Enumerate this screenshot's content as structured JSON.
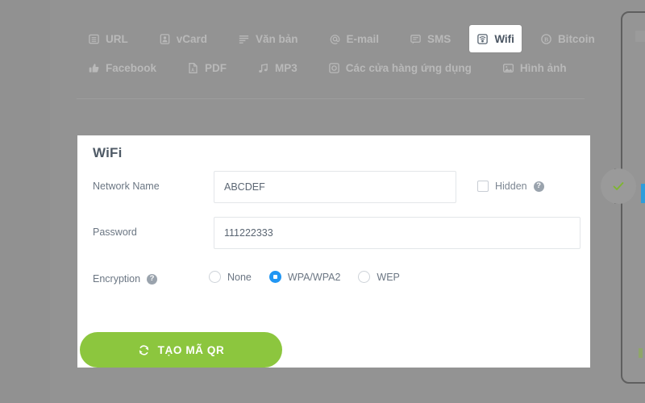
{
  "tabs": {
    "row1": [
      {
        "label": "URL",
        "icon": "document-icon",
        "active": false
      },
      {
        "label": "vCard",
        "icon": "contact-card-icon",
        "active": false
      },
      {
        "label": "Văn bản",
        "icon": "text-lines-icon",
        "active": false
      },
      {
        "label": "E-mail",
        "icon": "at-sign-icon",
        "active": false
      },
      {
        "label": "SMS",
        "icon": "speech-bubble-icon",
        "active": false
      },
      {
        "label": "Wifi",
        "icon": "wifi-icon",
        "active": true
      },
      {
        "label": "Bitcoin",
        "icon": "bitcoin-icon",
        "active": false
      }
    ],
    "row2": [
      {
        "label": "Facebook",
        "icon": "thumbs-up-icon",
        "active": false
      },
      {
        "label": "PDF",
        "icon": "pdf-file-icon",
        "active": false
      },
      {
        "label": "MP3",
        "icon": "music-note-icon",
        "active": false
      },
      {
        "label": "Các cửa hàng ứng dụng",
        "icon": "app-store-icon",
        "active": false
      },
      {
        "label": "Hình ảnh",
        "icon": "image-icon",
        "active": false
      }
    ]
  },
  "form": {
    "title": "WiFi",
    "network_name": {
      "label": "Network Name",
      "value": "ABCDEF",
      "placeholder": ""
    },
    "hidden": {
      "label": "Hidden",
      "checked": false,
      "help": "?"
    },
    "password": {
      "label": "Password",
      "value": "111222333",
      "placeholder": ""
    },
    "encryption": {
      "label": "Encryption",
      "help": "?",
      "selected": "WPA/WPA2",
      "options": [
        {
          "label": "None",
          "selected": false
        },
        {
          "label": "WPA/WPA2",
          "selected": true
        },
        {
          "label": "WEP",
          "selected": false
        }
      ]
    },
    "submit": {
      "label": "TẠO MÃ QR",
      "icon": "refresh-icon"
    }
  },
  "preview": {
    "status_icon": "check-icon"
  },
  "colors": {
    "accent_green": "#8cc63e",
    "accent_blue": "#2196f3",
    "page_bg": "#939393",
    "outer_bg": "#919191",
    "card_bg": "#ffffff",
    "label_text": "#6b7683",
    "tab_text": "#b9b9b9",
    "tab_active_text": "#4a5562"
  }
}
